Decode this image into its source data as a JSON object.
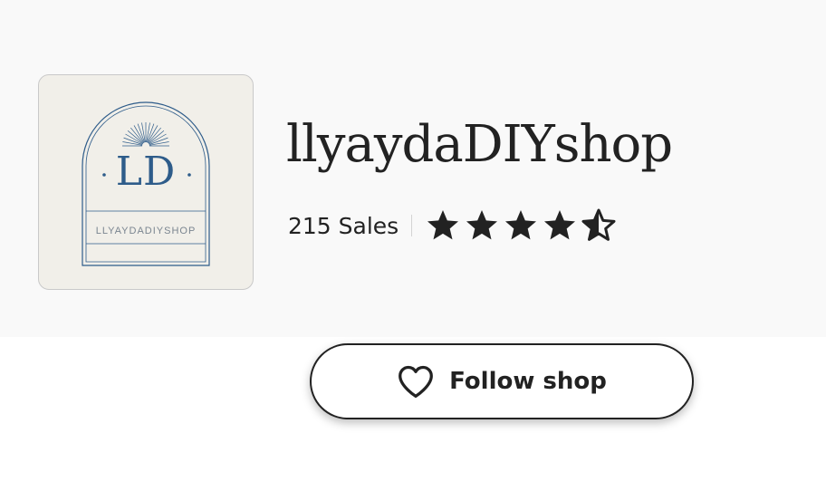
{
  "shop": {
    "name": "llyaydaDIYshop",
    "sales_text": "215 Sales",
    "rating": 4.5,
    "max_rating": 5
  },
  "logo": {
    "initials": "LD",
    "caption": "LLYAYDADIYSHOP",
    "accent_color": "#2e5c8a"
  },
  "follow": {
    "label": "Follow shop",
    "icon": "heart-outline-icon"
  },
  "colors": {
    "header_background": "#f9f9f9",
    "text": "#222222"
  }
}
